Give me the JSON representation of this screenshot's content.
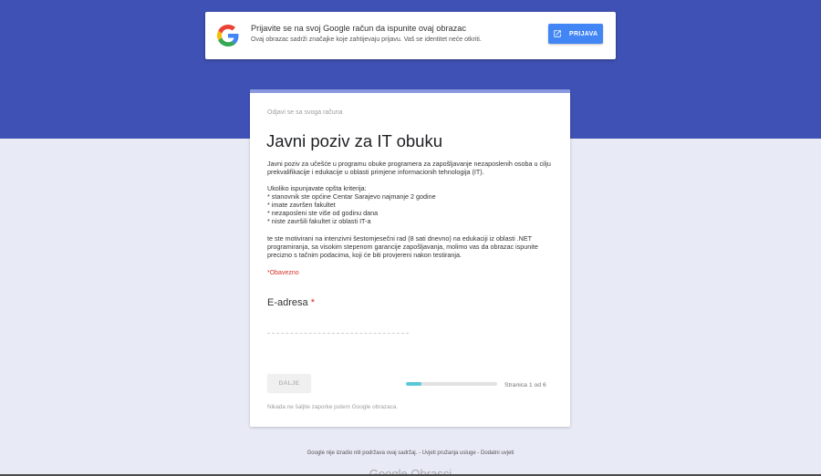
{
  "colors": {
    "header_bg": "#3f51b5",
    "page_bg": "#e8eaf6",
    "card_accent": "#8a98e0",
    "button_blue": "#4285f4",
    "required_red": "#d93025",
    "progress_fill": "#5bc8d9"
  },
  "signin_banner": {
    "logo_icon": "google-g-logo-icon",
    "title": "Prijavite se na svoj Google račun da ispunite ovaj obrazac",
    "subtitle": "Ovaj obrazac sadrži značajke koje zahtijevaju prijavu. Vaš se identitet neće otkriti.",
    "button_icon": "open-in-new-icon",
    "button_label": "PRIJAVA"
  },
  "form": {
    "account_line": "Odjavi se sa svoga računa",
    "title": "Javni poziv za IT obuku",
    "description": {
      "intro_lines": [
        "Javni poziv za učešće u programu obuke programera za zapošljavanje nezaposlenih osoba u cilju",
        "prekvalifikacije i edukacije u oblasti primjene informacionih tehnologija (IT)."
      ],
      "criteria_heading": "Ukoliko ispunjavate opšta kriterija:",
      "criteria": [
        "* stanovnik ste općine Centar Sarajevo najmanje 2 godine",
        "* imate završen fakultet",
        "* nezaposleni ste više od godinu dana",
        "* niste završili fakultet iz oblasti IT-a"
      ],
      "closing_lines": [
        "te ste motivirani na intenzivni šestomjesečni rad (8 sati dnevno) na edukaciji iz oblasti .NET",
        "programiranja, sa visokim stepenom garancije zapošljavanja, molimo vas da obrazac ispunite",
        "precizno s tačnim podacima, koji će biti provjereni nakon testiranja."
      ]
    },
    "required_note": "*Obavezno",
    "question": {
      "label": "E-adresa",
      "required_mark": "*"
    },
    "next_button": "DALJE",
    "progress": {
      "fraction": 0.1667,
      "label": "Stranica 1 od 6"
    },
    "password_warning": "Nikada ne šaljite zaporke putem Google obrazaca."
  },
  "footer": {
    "disclaimer": "Google nije izradio niti podržava ovaj sadržaj.",
    "separator": " - ",
    "links": [
      "Uvjeti pružanja usluge",
      "Dodatni uvjeti"
    ],
    "brand_logo": "Google Obrasci"
  }
}
